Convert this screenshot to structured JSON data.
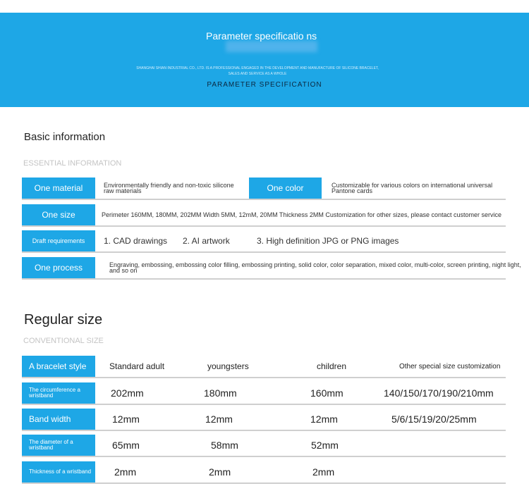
{
  "banner": {
    "title": "Parameter specificatio ns",
    "company": "SHANGHAI SHIAN INDUSTRIAL CO., LTD. IS A PROFESSIONAL ENGAGED IN THE DEVELOPMENT AND MANUFACTURE OF SILICONE BRACELET, SALES AND SERVICE AS A WHOLE",
    "subtitle": "PARAMETER SPECIFICATION"
  },
  "basic": {
    "title": "Basic information",
    "subtitle": "ESSENTIAL INFORMATION",
    "material_label": "One material",
    "material_value": "Environmentally friendly and non-toxic silicone raw materials",
    "color_label": "One color",
    "color_value": "Customizable for various colors on international universal Pantone cards",
    "size_label": "One size",
    "size_value": "Perimeter 160MM, 180MM, 202MM Width 5MM, 12mM, 20MM Thickness 2MM Customization for other sizes, please contact customer service",
    "draft_label": "Draft requirements",
    "draft_values": [
      "1. CAD drawings",
      "2. AI artwork",
      "3. High definition JPG or PNG images"
    ],
    "process_label": "One process",
    "process_value": "Engraving, embossing, embossing color filling, embossing printing, solid color, color separation, mixed color, multi-color, screen printing, night light, and so on"
  },
  "regular": {
    "title": "Regular size",
    "subtitle": "CONVENTIONAL SIZE",
    "header": {
      "label": "A bracelet style",
      "cells": [
        "Standard adult",
        "youngsters",
        "children",
        "Other special size customization"
      ]
    },
    "rows": [
      {
        "label": "The circumference a wristband",
        "cells": [
          "202mm",
          "180mm",
          "160mm",
          "140/150/170/190/210mm"
        ]
      },
      {
        "label": "Band width",
        "cells": [
          "12mm",
          "12mm",
          "12mm",
          "5/6/15/19/20/25mm"
        ]
      },
      {
        "label": "The diameter of a wristband",
        "cells": [
          "65mm",
          "58mm",
          "52mm",
          ""
        ]
      },
      {
        "label": "Thickness of a wristband",
        "cells": [
          "2mm",
          "2mm",
          "2mm",
          ""
        ]
      }
    ]
  }
}
